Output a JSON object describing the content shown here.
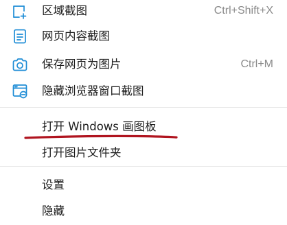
{
  "menu": {
    "items": [
      {
        "label": "区域截图",
        "shortcut": "Ctrl+Shift+X",
        "icon": "region-screenshot-icon"
      },
      {
        "label": "网页内容截图",
        "shortcut": "",
        "icon": "webpage-content-icon"
      },
      {
        "label": "保存网页为图片",
        "shortcut": "Ctrl+M",
        "icon": "camera-icon"
      },
      {
        "label": "隐藏浏览器窗口截图",
        "shortcut": "",
        "icon": "hidden-browser-window-icon"
      },
      {
        "label": "打开 Windows 画图板",
        "shortcut": "",
        "icon": ""
      },
      {
        "label": "打开图片文件夹",
        "shortcut": "",
        "icon": ""
      },
      {
        "label": "设置",
        "shortcut": "",
        "icon": ""
      },
      {
        "label": "隐藏",
        "shortcut": "",
        "icon": ""
      }
    ]
  },
  "colors": {
    "icon": "#1f8dd6",
    "annotation": "#b0141f",
    "separator": "#e6e6e6",
    "shortcut": "#8a8a8a"
  }
}
